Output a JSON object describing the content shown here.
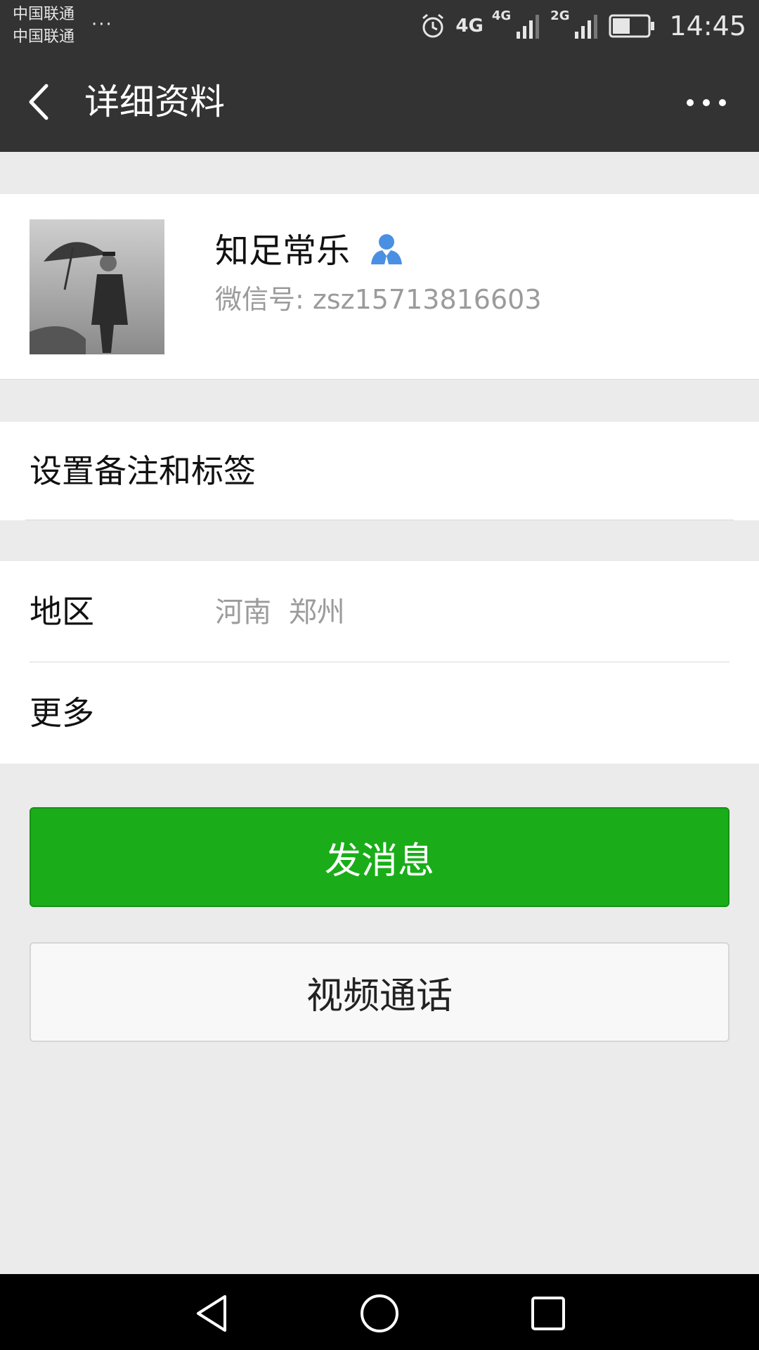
{
  "status_bar": {
    "carrier_1": "中国联通",
    "carrier_2": "中国联通",
    "more": "···",
    "network_1": "4G",
    "network_2": "4G",
    "network_3": "2G",
    "time": "14:45",
    "battery_level": 0.5,
    "icons": [
      "alarm-icon",
      "signal-icon",
      "battery-icon"
    ]
  },
  "nav": {
    "title": "详细资料",
    "back_icon": "chevron-left-icon",
    "menu_icon": "more-horizontal-icon"
  },
  "profile": {
    "name": "知足常乐",
    "wechat_id": "微信号: zsz15713816603",
    "avatar_icon": "avatar-photo",
    "badge_icon": "person-icon"
  },
  "remark": {
    "label": "设置备注和标签"
  },
  "info": {
    "region_label": "地区",
    "region_value": "河南 郑州",
    "more_label": "更多"
  },
  "actions": {
    "send_message": "发消息",
    "video_call": "视频通话"
  },
  "colors": {
    "header": "#333333",
    "background": "#ebebeb",
    "primary": "#1aad19",
    "secondary_text": "#9b9b9b",
    "badge": "#4a90e2"
  },
  "system_nav": {
    "icons": [
      "back-triangle-icon",
      "home-circle-icon",
      "recent-square-icon"
    ]
  }
}
